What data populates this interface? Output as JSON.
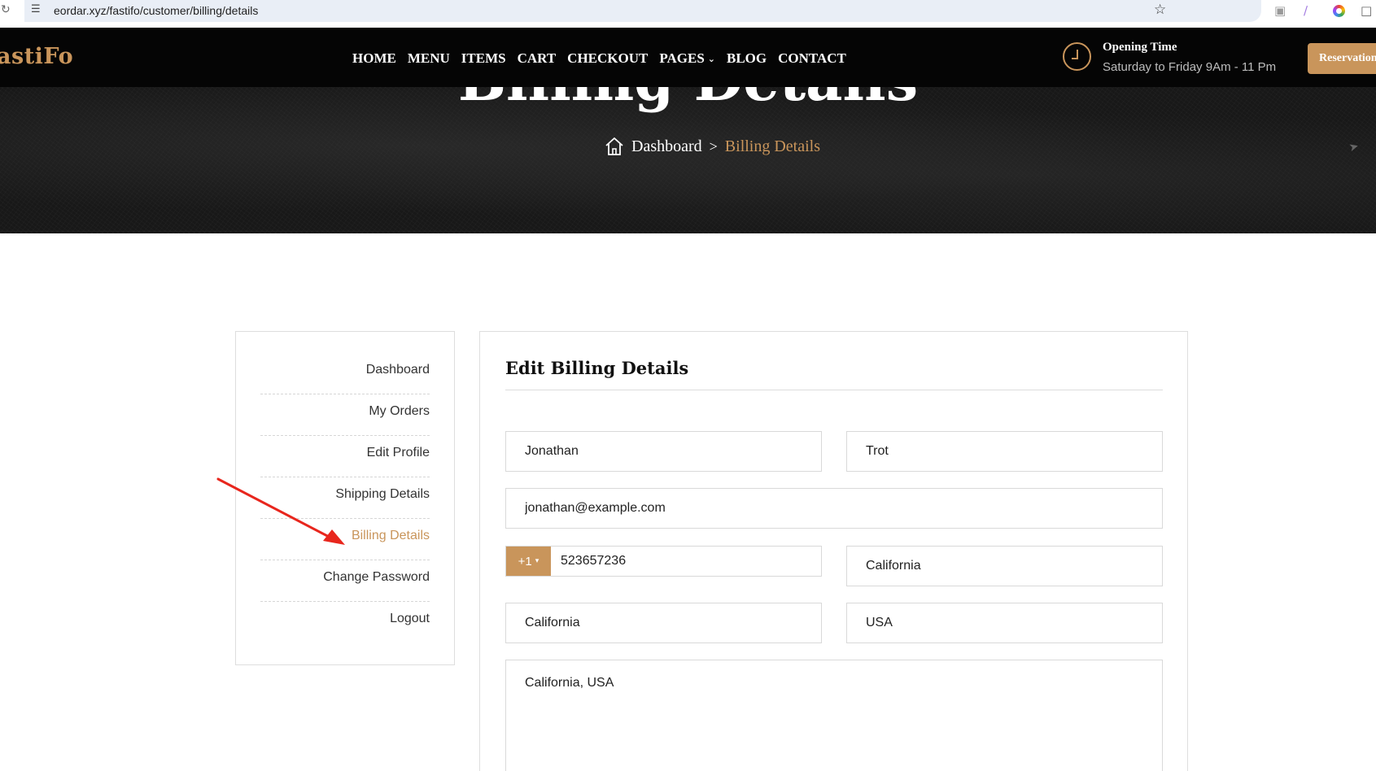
{
  "browser": {
    "url": "eordar.xyz/fastifo/customer/billing/details",
    "reload_icon": "reload-icon",
    "site_info_icon": "site-info-icon",
    "bookmark_icon": "star-icon",
    "extension_icons": [
      "camera-icon",
      "pen-icon",
      "color-picker-icon",
      "puzzle-icon"
    ]
  },
  "header": {
    "logo": "astiFo",
    "nav": [
      "HOME",
      "MENU",
      "ITEMS",
      "CART",
      "CHECKOUT",
      "PAGES",
      "BLOG",
      "CONTACT"
    ],
    "opening_title": "Opening Time",
    "opening_hours": "Saturday to Friday 9Am - 11 Pm",
    "reservation_label": "Reservation"
  },
  "hero": {
    "title": "Billing Details",
    "breadcrumb": {
      "home": "Dashboard",
      "separator": ">",
      "current": "Billing Details"
    }
  },
  "sidebar": {
    "items": [
      {
        "label": "Dashboard",
        "active": false
      },
      {
        "label": "My Orders",
        "active": false
      },
      {
        "label": "Edit Profile",
        "active": false
      },
      {
        "label": "Shipping Details",
        "active": false
      },
      {
        "label": "Billing Details",
        "active": true
      },
      {
        "label": "Change Password",
        "active": false
      },
      {
        "label": "Logout",
        "active": false
      }
    ]
  },
  "form": {
    "title": "Edit Billing Details",
    "first_name": "Jonathan",
    "last_name": "Trot",
    "email": "jonathan@example.com",
    "dial_code": "+1",
    "phone": "523657236",
    "state": "California",
    "city": "California",
    "country": "USA",
    "address": "California, USA"
  },
  "colors": {
    "accent": "#c9955b",
    "header_bg": "#050505",
    "annotation_arrow": "#e8261d"
  }
}
